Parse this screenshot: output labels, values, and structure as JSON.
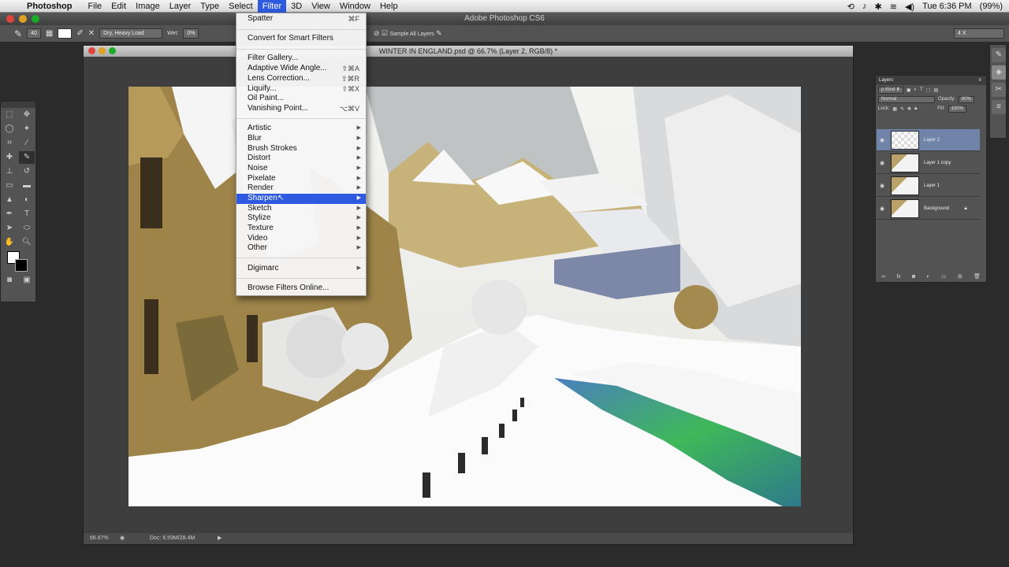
{
  "menubar": {
    "app_name": "Photoshop",
    "items": [
      "File",
      "Edit",
      "Image",
      "Layer",
      "Type",
      "Select",
      "Filter",
      "3D",
      "View",
      "Window",
      "Help"
    ],
    "active": "Filter",
    "clock": "Tue 6:36 PM",
    "battery": "(99%)"
  },
  "appbar": {
    "title": "Adobe Photoshop CS6"
  },
  "options_bar": {
    "brush_size": "40",
    "preset": "Dry, Heavy Load",
    "wet_label": "Wet:",
    "wet_value": "0%",
    "sample_all_layers": "Sample All Layers",
    "zoom_field": "4 X"
  },
  "document": {
    "title": "WINTER IN ENGLAND.psd @ 66.7% (Layer 2, RGB/8) *",
    "zoom": "66.67%",
    "doc_size": "Doc: 6.59M/28.4M"
  },
  "filter_menu": {
    "top": [
      "Spatter",
      "Convert for Smart Filters"
    ],
    "shortcut_spatter": "⌘F",
    "filters": [
      {
        "label": "Filter Gallery...",
        "shortcut": ""
      },
      {
        "label": "Adaptive Wide Angle...",
        "shortcut": "⇧⌘A"
      },
      {
        "label": "Lens Correction...",
        "shortcut": "⇧⌘R"
      },
      {
        "label": "Liquify...",
        "shortcut": "⇧⌘X"
      },
      {
        "label": "Oil Paint...",
        "shortcut": ""
      },
      {
        "label": "Vanishing Point...",
        "shortcut": "⌥⌘V"
      }
    ],
    "submenus": [
      "Artistic",
      "Blur",
      "Brush Strokes",
      "Distort",
      "Noise",
      "Pixelate",
      "Render",
      "Sharpen",
      "Sketch",
      "Stylize",
      "Texture",
      "Video",
      "Other"
    ],
    "highlighted": "Sharpen",
    "digimarc": "Digimarc",
    "browse": "Browse Filters Online..."
  },
  "layers_panel": {
    "tab": "Layers",
    "kind": "Kind",
    "blend_mode": "Normal",
    "opacity_label": "Opacity:",
    "opacity": "80%",
    "lock_label": "Lock:",
    "fill_label": "Fill:",
    "fill": "100%",
    "layers": [
      "Layer 2",
      "Layer 1 copy",
      "Layer 1",
      "Background"
    ]
  },
  "colors": {
    "menu_highlight": "#2d5ae0",
    "active_layer": "#6f84a8",
    "panel_bg": "#535353"
  }
}
